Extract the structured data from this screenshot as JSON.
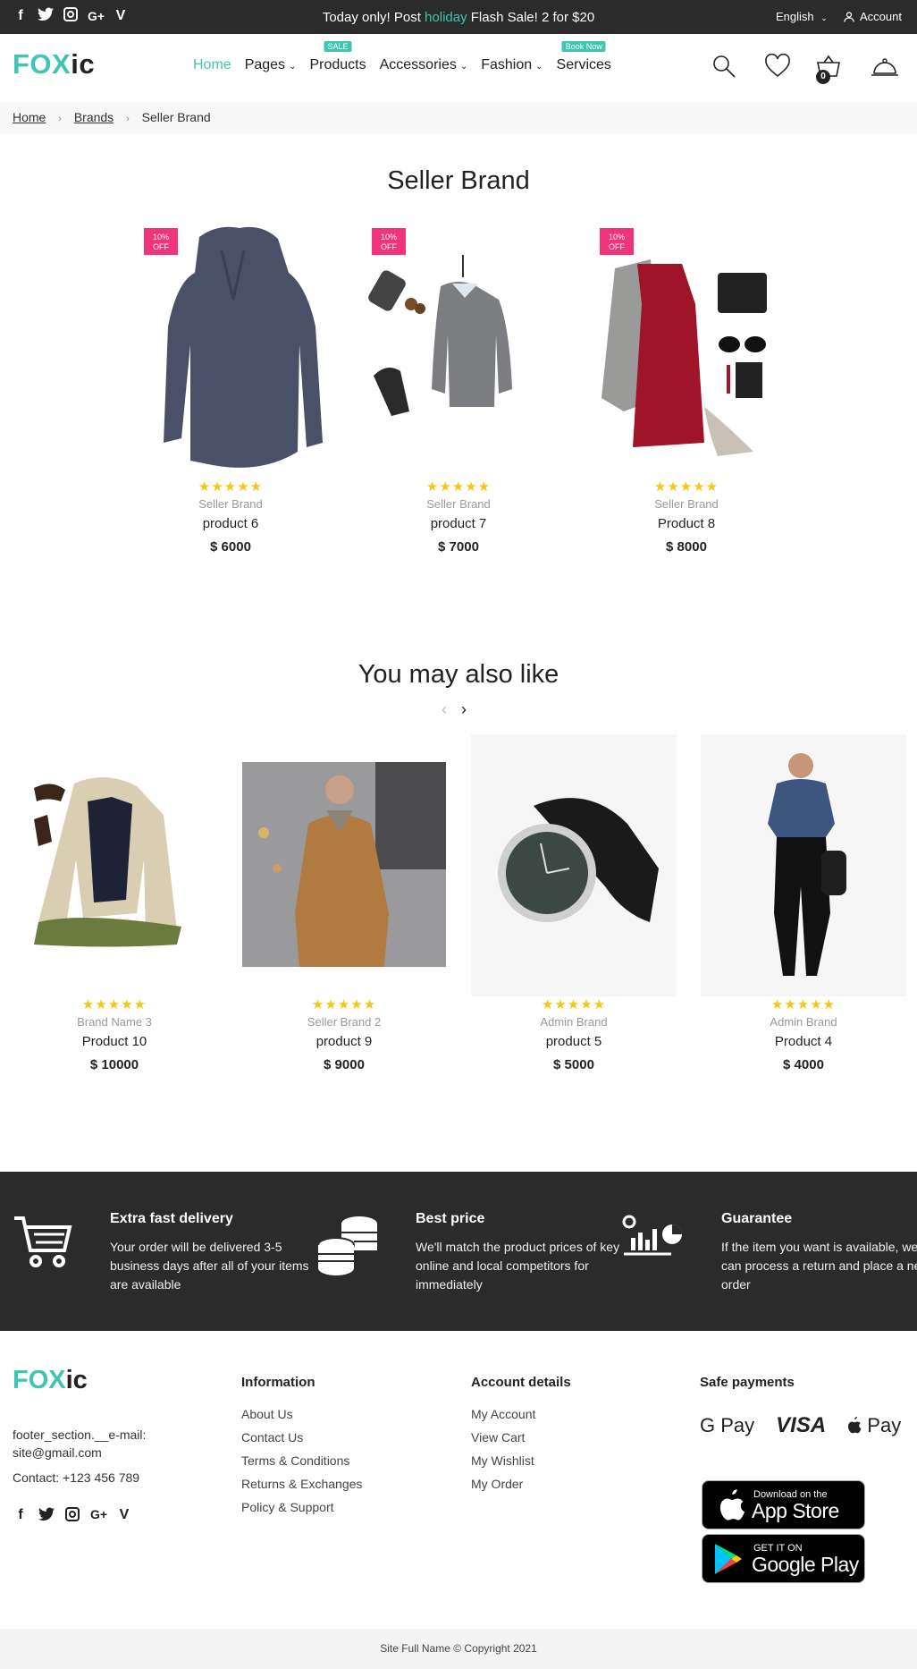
{
  "topbar": {
    "social_icons": [
      "facebook-icon",
      "twitter-icon",
      "instagram-icon",
      "google-plus-icon",
      "vimeo-icon"
    ],
    "promo_before": "Today only! Post ",
    "promo_highlight": "holiday",
    "promo_after": " Flash Sale! 2 for $20",
    "language": "English",
    "account": "Account"
  },
  "header": {
    "logo_part1": "FOX",
    "logo_part2": "ic",
    "nav": [
      {
        "label": "Home",
        "active": true
      },
      {
        "label": "Pages",
        "caret": true
      },
      {
        "label": "Products",
        "badge": "SALE"
      },
      {
        "label": "Accessories",
        "caret": true
      },
      {
        "label": "Fashion",
        "caret": true
      },
      {
        "label": "Services",
        "badge": "Book Now"
      }
    ],
    "cart_count": "0"
  },
  "breadcrumb": {
    "home": "Home",
    "brands": "Brands",
    "current": "Seller Brand"
  },
  "page_title": "Seller Brand",
  "products": [
    {
      "discount_line1": "10%",
      "discount_line2": "OFF",
      "stars": "★★★★★",
      "brand": "Seller Brand",
      "name": "product 6",
      "price": "$ 6000"
    },
    {
      "discount_line1": "10%",
      "discount_line2": "OFF",
      "stars": "★★★★★",
      "brand": "Seller Brand",
      "name": "product 7",
      "price": "$ 7000"
    },
    {
      "discount_line1": "10%",
      "discount_line2": "OFF",
      "stars": "★★★★★",
      "brand": "Seller Brand",
      "name": "Product 8",
      "price": "$ 8000"
    }
  ],
  "related_title": "You may also like",
  "related": [
    {
      "stars": "★★★★★",
      "brand": "Brand Name 3",
      "name": "Product 10",
      "price": "$ 10000"
    },
    {
      "stars": "★★★★★",
      "brand": "Seller Brand 2",
      "name": "product 9",
      "price": "$ 9000"
    },
    {
      "stars": "★★★★★",
      "brand": "Admin Brand",
      "name": "product 5",
      "price": "$ 5000"
    },
    {
      "stars": "★★★★★",
      "brand": "Admin Brand",
      "name": "Product 4",
      "price": "$ 4000"
    }
  ],
  "features": [
    {
      "icon": "shopping-cart-icon",
      "title": "Extra fast delivery",
      "text": "Your order will be delivered 3-5 business days after all of your items are available"
    },
    {
      "icon": "coins-icon",
      "title": "Best price",
      "text": "We'll match the product prices of key online and local competitors for immediately"
    },
    {
      "icon": "chart-guarantee-icon",
      "title": "Guarantee",
      "text": "If the item you want is available, we can process a return and place a new order"
    }
  ],
  "footer": {
    "logo_part1": "FOX",
    "logo_part2": "ic",
    "email_line": "footer_section.__e-mail: site@gmail.com",
    "contact_line": "Contact: +123 456 789",
    "information_title": "Information",
    "information_links": [
      "About Us",
      "Contact Us",
      "Terms & Conditions",
      "Returns & Exchanges",
      "Policy & Support"
    ],
    "account_title": "Account details",
    "account_links": [
      "My Account",
      "View Cart",
      "My Wishlist",
      "My Order"
    ],
    "payments_title": "Safe payments",
    "pay_gpay": "G Pay",
    "pay_visa": "VISA",
    "pay_apple": "Pay",
    "appstore_small": "Download on the",
    "appstore_big": "App Store",
    "googleplay_small": "GET IT ON",
    "googleplay_big": "Google Play"
  },
  "copyright": "Site Full Name © Copyright 2021",
  "colors": {
    "accent": "#3ec6b0",
    "dark": "#2b2b2b",
    "sale": "#f0337b",
    "star": "#f8c514"
  }
}
